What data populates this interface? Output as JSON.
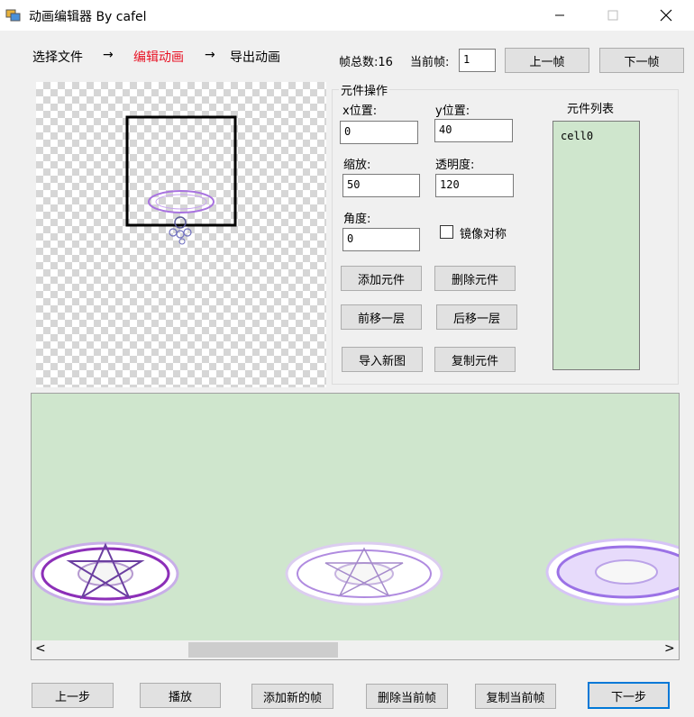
{
  "window": {
    "title": "动画编辑器 By cafel",
    "minimize_label": "–",
    "maximize_label": "☐",
    "close_label": "✕"
  },
  "steps": {
    "select_file": "选择文件",
    "edit_animation": "编辑动画",
    "export_animation": "导出动画",
    "arrow": "→",
    "active_color": "#e81123"
  },
  "frames": {
    "total_label": "帧总数:16",
    "current_label": "当前帧:",
    "current_value": "1",
    "prev_frame": "上一帧",
    "next_frame": "下一帧"
  },
  "element_ops": {
    "group_title": "元件操作",
    "x_label": "x位置:",
    "x_value": "0",
    "y_label": "y位置:",
    "y_value": "40",
    "scale_label": "缩放:",
    "scale_value": "50",
    "opacity_label": "透明度:",
    "opacity_value": "120",
    "angle_label": "角度:",
    "angle_value": "0",
    "mirror_label": "镜像对称",
    "mirror_checked": false,
    "add_element": "添加元件",
    "delete_element": "删除元件",
    "move_forward": "前移一层",
    "move_back": "后移一层",
    "import_image": "导入新图",
    "copy_element": "复制元件"
  },
  "element_list": {
    "title": "元件列表",
    "items": [
      "cell0"
    ]
  },
  "bottom": {
    "prev_step": "上一步",
    "play": "播放",
    "add_frame": "添加新的帧",
    "delete_frame": "删除当前帧",
    "copy_frame": "复制当前帧",
    "next_step": "下一步"
  },
  "scrollbar": {
    "left_arrow": "<",
    "right_arrow": ">"
  },
  "colors": {
    "panel_green": "#cfe6cd",
    "circle_purple": "#9b4fd6"
  }
}
